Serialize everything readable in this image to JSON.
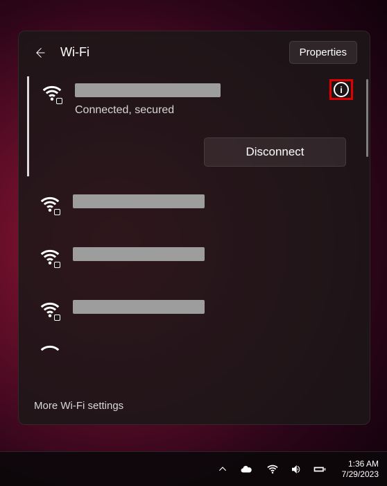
{
  "header": {
    "title": "Wi-Fi",
    "properties_label": "Properties"
  },
  "connected": {
    "status": "Connected, secured",
    "info_glyph": "i",
    "disconnect_label": "Disconnect"
  },
  "footer": {
    "more_label": "More Wi-Fi settings"
  },
  "taskbar": {
    "time": "1:36 AM",
    "date": "7/29/2023"
  }
}
